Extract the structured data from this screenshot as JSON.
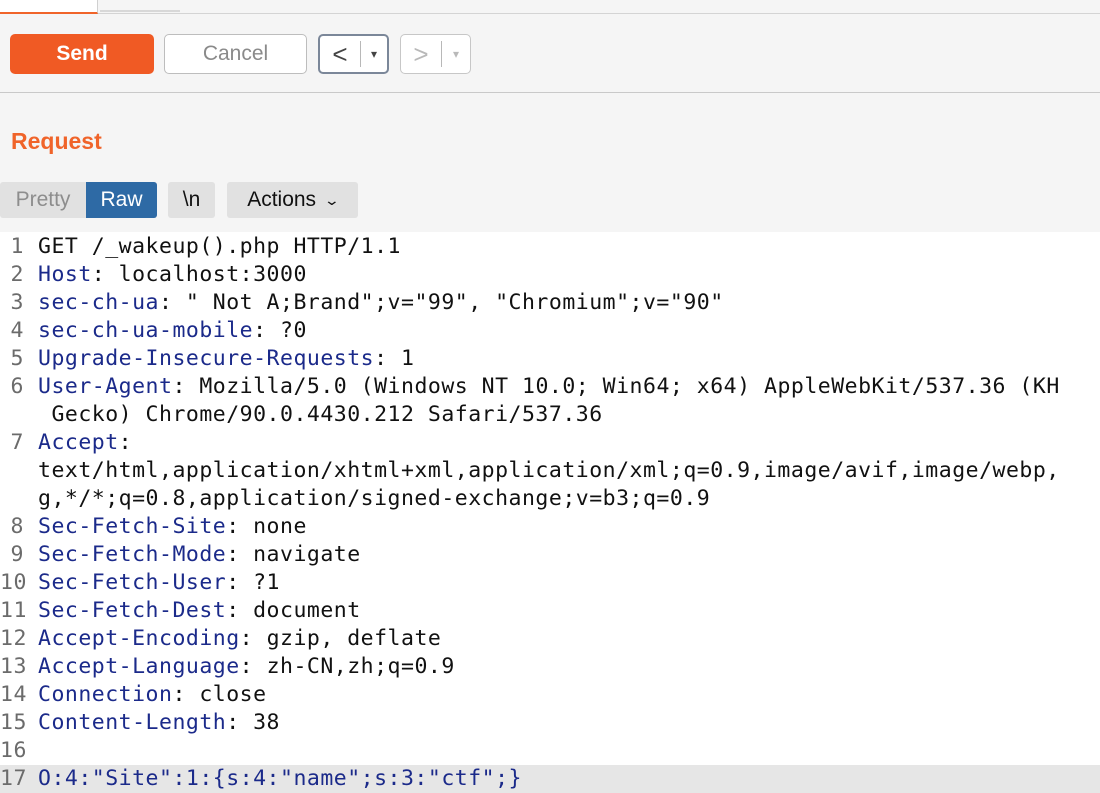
{
  "toolbar": {
    "send_label": "Send",
    "cancel_label": "Cancel",
    "back_glyph": "<",
    "forward_glyph": ">",
    "dropdown_glyph": "▾"
  },
  "colors": {
    "accent": "#f05a24",
    "raw_active": "#2e6aa5",
    "header_key": "#1b2a8a"
  },
  "request": {
    "title": "Request",
    "view_tabs": {
      "pretty": "Pretty",
      "raw": "Raw",
      "newline": "\\n",
      "actions": "Actions"
    },
    "lines": [
      {
        "n": "1",
        "plain": "GET /_wakeup().php HTTP/1.1"
      },
      {
        "n": "2",
        "key": "Host",
        "sep": ": ",
        "value": "localhost:3000"
      },
      {
        "n": "3",
        "key": "sec-ch-ua",
        "sep": ": ",
        "value": "\" Not A;Brand\";v=\"99\", \"Chromium\";v=\"90\""
      },
      {
        "n": "4",
        "key": "sec-ch-ua-mobile",
        "sep": ": ",
        "value": "?0"
      },
      {
        "n": "5",
        "key": "Upgrade-Insecure-Requests",
        "sep": ": ",
        "value": "1"
      },
      {
        "n": "6",
        "key": "User-Agent",
        "sep": ": ",
        "value": "Mozilla/5.0 (Windows NT 10.0; Win64; x64) AppleWebKit/537.36 (KH"
      },
      {
        "n": "",
        "plain": " Gecko) Chrome/90.0.4430.212 Safari/537.36"
      },
      {
        "n": "7",
        "key": "Accept",
        "sep": ":",
        "value": ""
      },
      {
        "n": "",
        "plain": "text/html,application/xhtml+xml,application/xml;q=0.9,image/avif,image/webp,"
      },
      {
        "n": "",
        "plain": "g,*/*;q=0.8,application/signed-exchange;v=b3;q=0.9"
      },
      {
        "n": "8",
        "key": "Sec-Fetch-Site",
        "sep": ": ",
        "value": "none"
      },
      {
        "n": "9",
        "key": "Sec-Fetch-Mode",
        "sep": ": ",
        "value": "navigate"
      },
      {
        "n": "10",
        "key": "Sec-Fetch-User",
        "sep": ": ",
        "value": "?1"
      },
      {
        "n": "11",
        "key": "Sec-Fetch-Dest",
        "sep": ": ",
        "value": "document"
      },
      {
        "n": "12",
        "key": "Accept-Encoding",
        "sep": ": ",
        "value": "gzip, deflate"
      },
      {
        "n": "13",
        "key": "Accept-Language",
        "sep": ": ",
        "value": "zh-CN,zh;q=0.9"
      },
      {
        "n": "14",
        "key": "Connection",
        "sep": ": ",
        "value": "close"
      },
      {
        "n": "15",
        "key": "Content-Length",
        "sep": ": ",
        "value": "38"
      },
      {
        "n": "16",
        "plain": ""
      },
      {
        "n": "17",
        "body": "O:4:\"Site\":1:{s:4:\"name\";s:3:\"ctf\";}",
        "highlighted": true
      }
    ]
  }
}
